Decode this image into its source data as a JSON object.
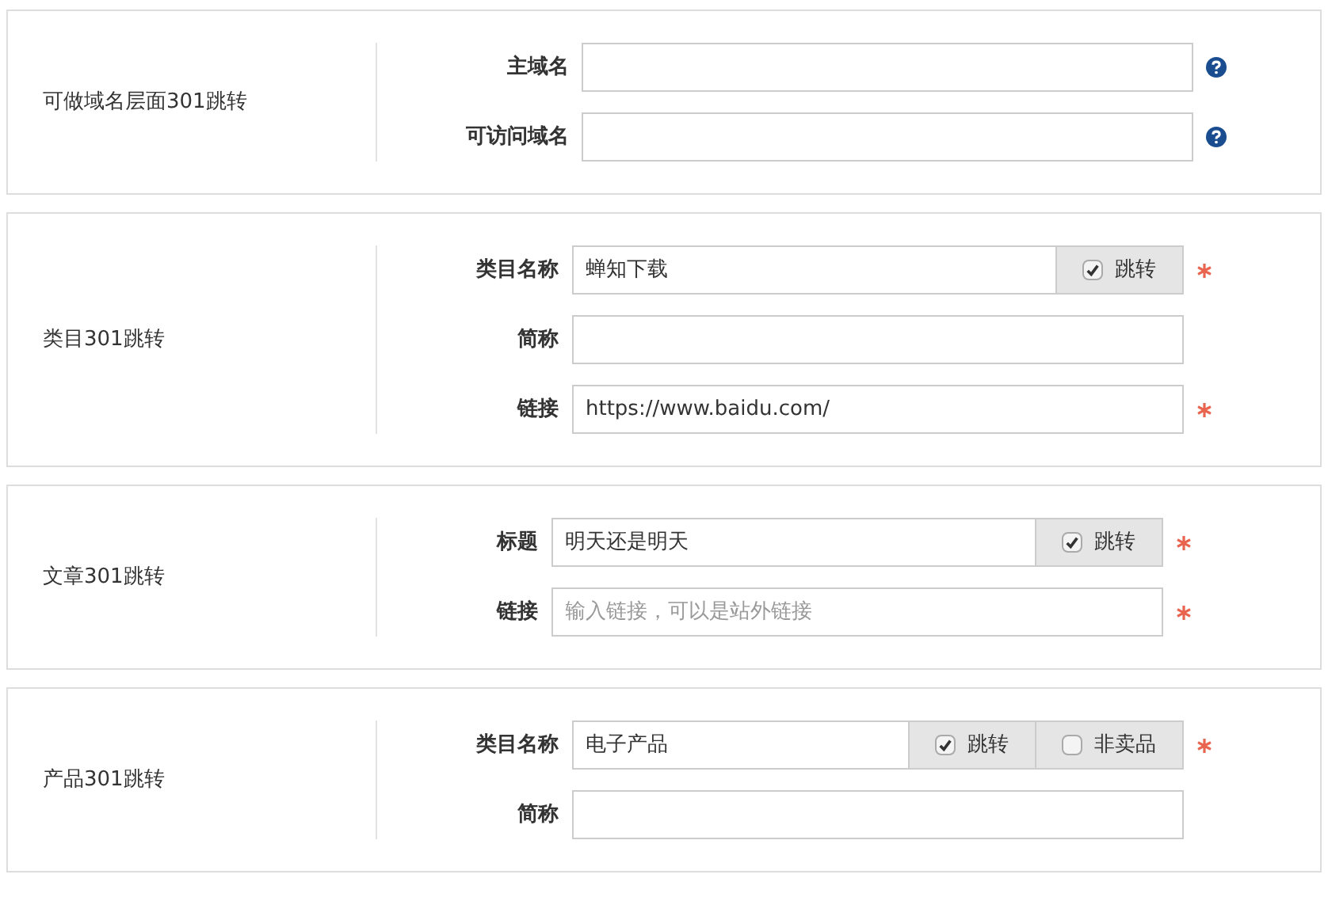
{
  "sections": [
    {
      "title": "可做域名层面301跳转",
      "fields": [
        {
          "label": "主域名",
          "help": true
        },
        {
          "label": "可访问域名",
          "help": true
        }
      ]
    },
    {
      "title": "类目301跳转",
      "fields": [
        {
          "label": "类目名称",
          "value": "蝉知下载",
          "required": true,
          "addons": [
            {
              "label": "跳转",
              "checked": true
            }
          ]
        },
        {
          "label": "简称"
        },
        {
          "label": "链接",
          "value": "https://www.baidu.com/",
          "required": true
        }
      ]
    },
    {
      "title": "文章301跳转",
      "fields": [
        {
          "label": "标题",
          "value": "明天还是明天",
          "required": true,
          "addons": [
            {
              "label": "跳转",
              "checked": true
            }
          ]
        },
        {
          "label": "链接",
          "placeholder": "输入链接，可以是站外链接",
          "required": true
        }
      ]
    },
    {
      "title": "产品301跳转",
      "fields": [
        {
          "label": "类目名称",
          "value": "电子产品",
          "required": true,
          "addons": [
            {
              "label": "跳转",
              "checked": true
            },
            {
              "label": "非卖品",
              "checked": false
            }
          ]
        },
        {
          "label": "简称"
        }
      ]
    }
  ]
}
